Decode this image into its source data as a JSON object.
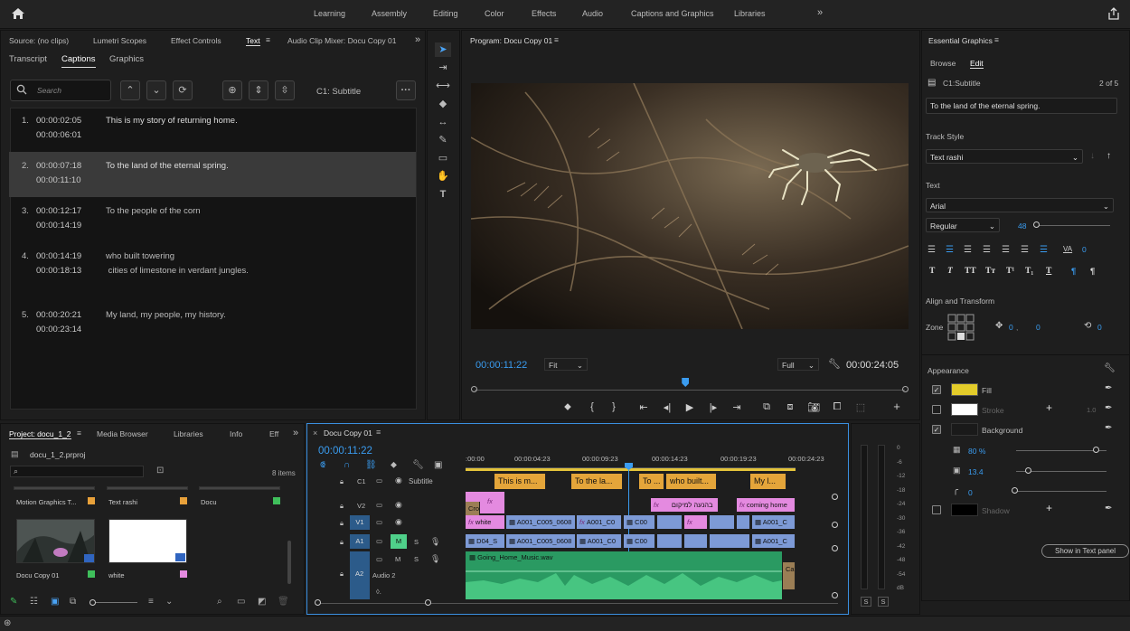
{
  "workspaces": [
    "Learning",
    "Assembly",
    "Editing",
    "Color",
    "Effects",
    "Audio",
    "Captions and Graphics",
    "Libraries"
  ],
  "source_tabs": [
    "Source: (no clips)",
    "Lumetri Scopes",
    "Effect Controls",
    "Text",
    "Audio Clip Mixer: Docu Copy 01"
  ],
  "text_subtabs": [
    "Transcript",
    "Captions",
    "Graphics"
  ],
  "captions_toolbar": {
    "search_placeholder": "Search",
    "track_label": "C1: Subtitle"
  },
  "captions": [
    {
      "n": "1.",
      "in": "00:00:02:05",
      "out": "00:00:06:01",
      "line1": "This is my story of returning home.",
      "line2": ""
    },
    {
      "n": "2.",
      "in": "00:00:07:18",
      "out": "00:00:11:10",
      "line1": "To the land of the eternal spring.",
      "line2": ""
    },
    {
      "n": "3.",
      "in": "00:00:12:17",
      "out": "00:00:14:19",
      "line1": "To the people of the corn",
      "line2": ""
    },
    {
      "n": "4.",
      "in": "00:00:14:19",
      "out": "00:00:18:13",
      "line1": "who built towering",
      "line2": " cities of limestone in verdant jungles."
    },
    {
      "n": "5.",
      "in": "00:00:20:21",
      "out": "00:00:23:14",
      "line1": "My land, my people, my history.",
      "line2": ""
    }
  ],
  "program": {
    "title": "Program: Docu Copy 01",
    "timecode": "00:00:11:22",
    "fit": "Fit",
    "quality": "Full",
    "duration": "00:00:24:05",
    "playhead_fraction": 0.49
  },
  "essential_graphics": {
    "title": "Essential Graphics",
    "tabs": [
      "Browse",
      "Edit"
    ],
    "layer": "C1:Subtitle",
    "page": "2 of 5",
    "text_value": "To the land of the eternal spring.",
    "track_style_label": "Track Style",
    "track_style": "Text rashi",
    "text_label": "Text",
    "font": "Arial",
    "font_style": "Regular",
    "font_size": "48",
    "align_label": "Align and Transform",
    "zone_label": "Zone",
    "pos_x": "0",
    "pos_y": "0",
    "rot": "0",
    "text_format_icons": [
      "T",
      "T",
      "TT",
      "Tт",
      "T¹",
      "T₁",
      "T",
      "T"
    ],
    "kerning": "0",
    "tracking_icon": "VA",
    "appearance_label": "Appearance",
    "fill_label": "Fill",
    "fill_color": "#e3cc2a",
    "stroke_label": "Stroke",
    "stroke_value": "1.0",
    "background_label": "Background",
    "opacity": "80 %",
    "size": "13.4",
    "corner": "0",
    "shadow_label": "Shadow",
    "show_button": "Show in Text panel"
  },
  "project": {
    "tabs": [
      "Project: docu_1_2",
      "Media Browser",
      "Libraries",
      "Info",
      "Eff"
    ],
    "file": "docu_1_2.prproj",
    "count": "8 items",
    "items": [
      {
        "name": "Motion Graphics T...",
        "color": "#e8a13a"
      },
      {
        "name": "Text rashi",
        "color": "#e8a13a"
      },
      {
        "name": "Docu",
        "color": "#3fbf5b"
      },
      {
        "name": "Docu Copy 01",
        "color": "#3fbf5b"
      },
      {
        "name": "white",
        "color": "#e48ae0"
      }
    ]
  },
  "timeline": {
    "title": "Docu Copy 01",
    "timecode": "00:00:11:22",
    "ruler": [
      ":00:00",
      "00:00:04:23",
      "00:00:09:23",
      "00:00:14:23",
      "00:00:19:23",
      "00:00:24:23"
    ],
    "tracks": {
      "c1": "C1",
      "subtitle": "Subtitle",
      "v2": "V2",
      "v1": "V1",
      "a1": "A1",
      "a2": "A2",
      "audio2": "Audio 2",
      "m": "M",
      "s": "S"
    },
    "caption_clips": [
      "This is m...",
      "To the la...",
      "To ...",
      "who built...",
      "My l..."
    ],
    "v2_clips": [
      "בהנעה למיקום",
      "coming home"
    ],
    "v1_clips": [
      "white",
      "A001_C005_0608",
      "A001_C0",
      "C00",
      "A001_C"
    ],
    "a1_clips": [
      "D04_S",
      "A001_C005_0608",
      "A001_C0",
      "C00",
      "A001_C"
    ],
    "a2_clip": "Going_Home_Music.wav",
    "cro": "Cro",
    "ca": "Ca"
  },
  "meter_ticks": [
    "0",
    "-6",
    "-12",
    "-18",
    "-24",
    "-30",
    "-36",
    "-42",
    "-48",
    "-54",
    "dB"
  ],
  "meter_buttons": [
    "S",
    "S"
  ]
}
